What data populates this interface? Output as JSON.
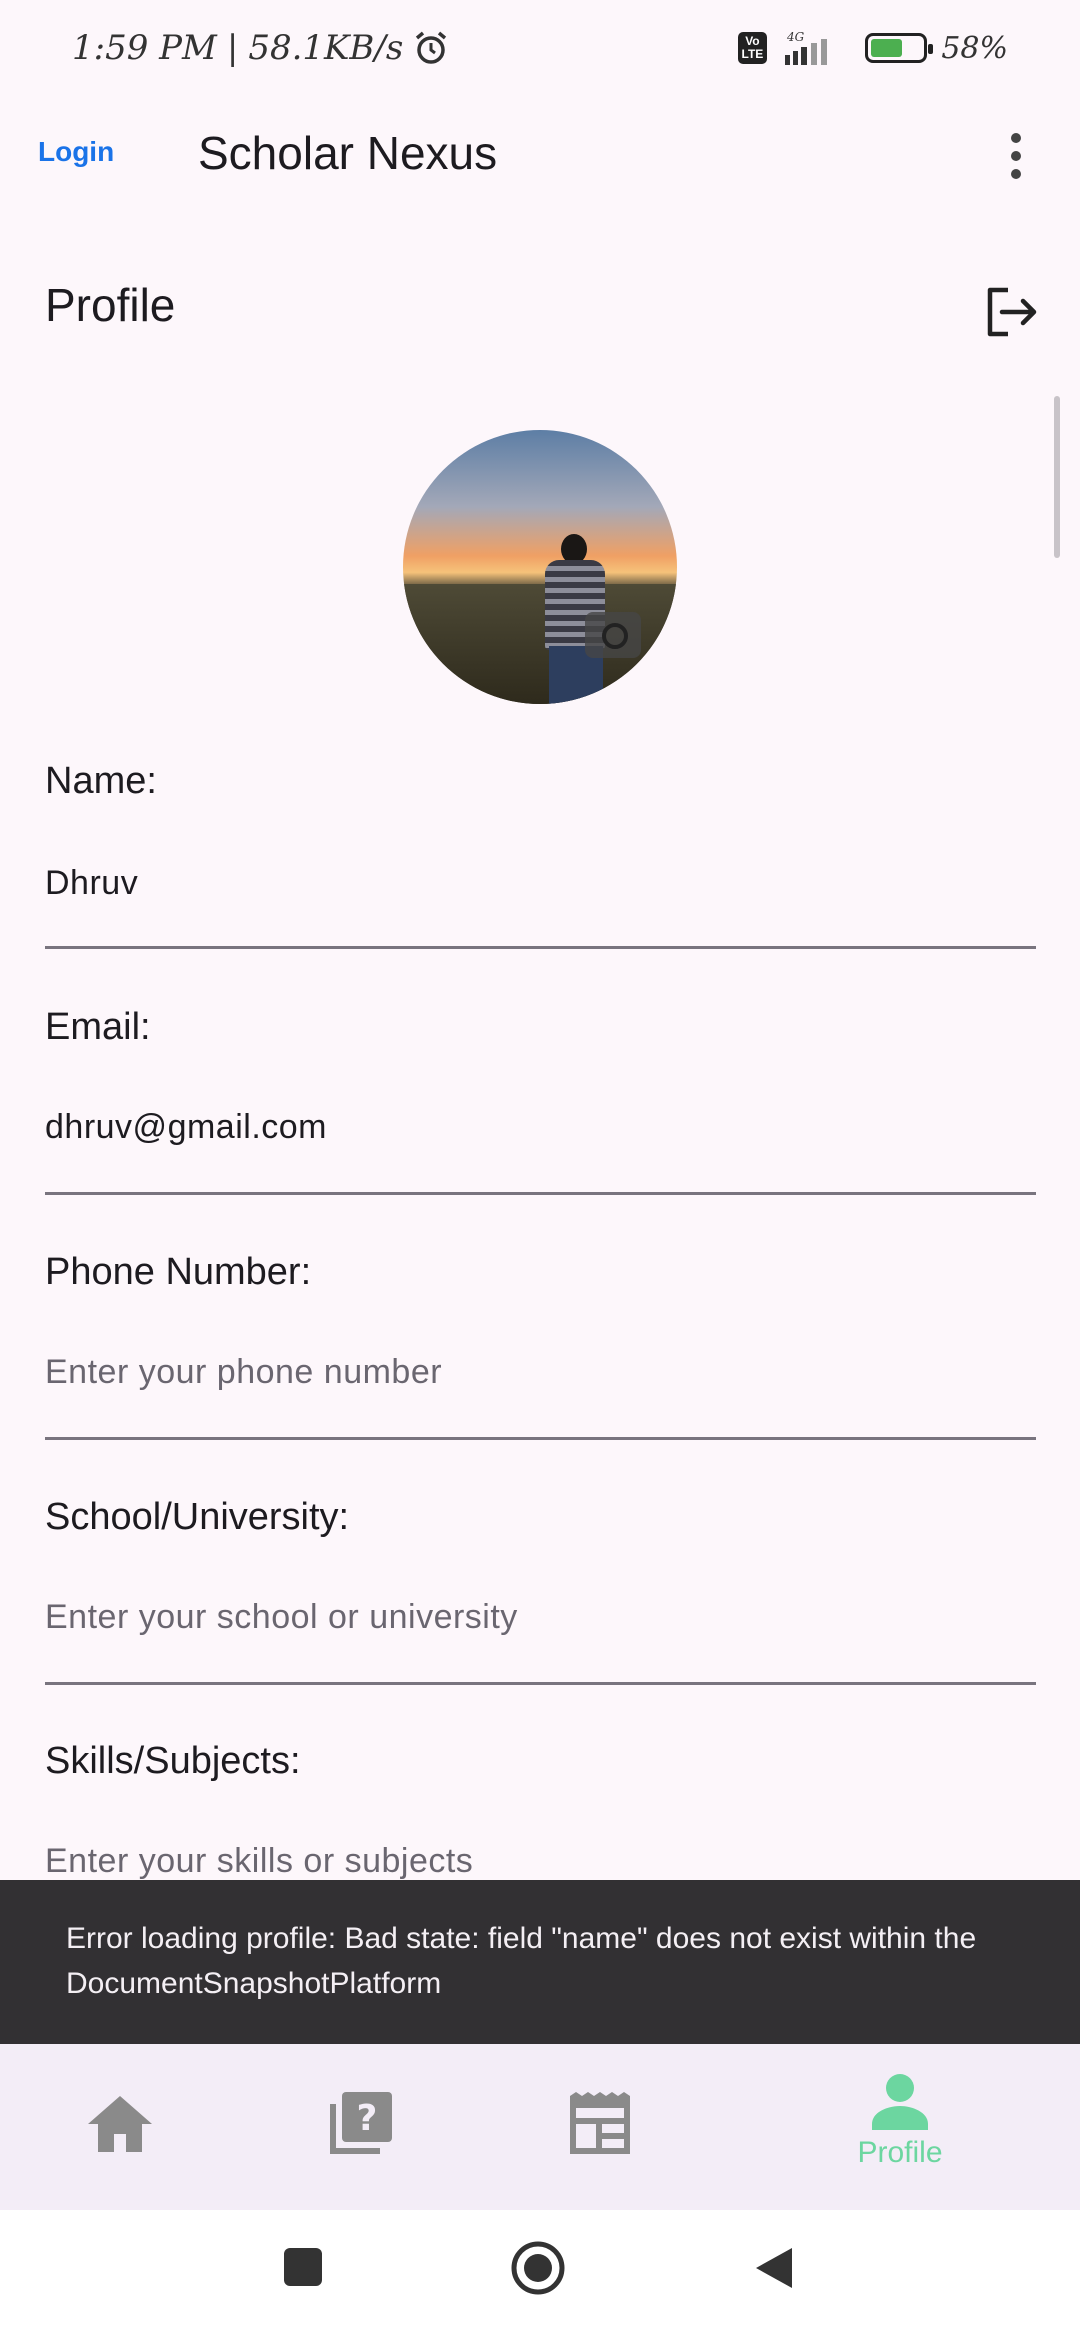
{
  "status_bar": {
    "time": "1:59 PM",
    "speed": "58.1KB/s",
    "volte": "Vo\nLTE",
    "network": "4G",
    "battery": "58%"
  },
  "app_bar": {
    "login": "Login",
    "title": "Scholar Nexus"
  },
  "profile": {
    "title": "Profile",
    "fields": [
      {
        "label": "Name:",
        "value": "Dhruv",
        "placeholder": ""
      },
      {
        "label": "Email:",
        "value": "dhruv@gmail.com",
        "placeholder": ""
      },
      {
        "label": "Phone Number:",
        "value": "",
        "placeholder": "Enter your phone number"
      },
      {
        "label": "School/University:",
        "value": "",
        "placeholder": "Enter your school or university"
      },
      {
        "label": "Skills/Subjects:",
        "value": "",
        "placeholder": "Enter your skills or subjects"
      }
    ]
  },
  "snackbar": {
    "message": "Error loading profile: Bad state: field \"name\" does not exist within the DocumentSnapshotPlatform"
  },
  "bottom_nav": {
    "items": [
      {
        "icon": "home-icon",
        "label": ""
      },
      {
        "icon": "quiz-icon",
        "label": ""
      },
      {
        "icon": "news-icon",
        "label": ""
      },
      {
        "icon": "person-icon",
        "label": "Profile"
      }
    ],
    "active_color": "#6cd6a0",
    "inactive_color": "#8a8a8a"
  }
}
